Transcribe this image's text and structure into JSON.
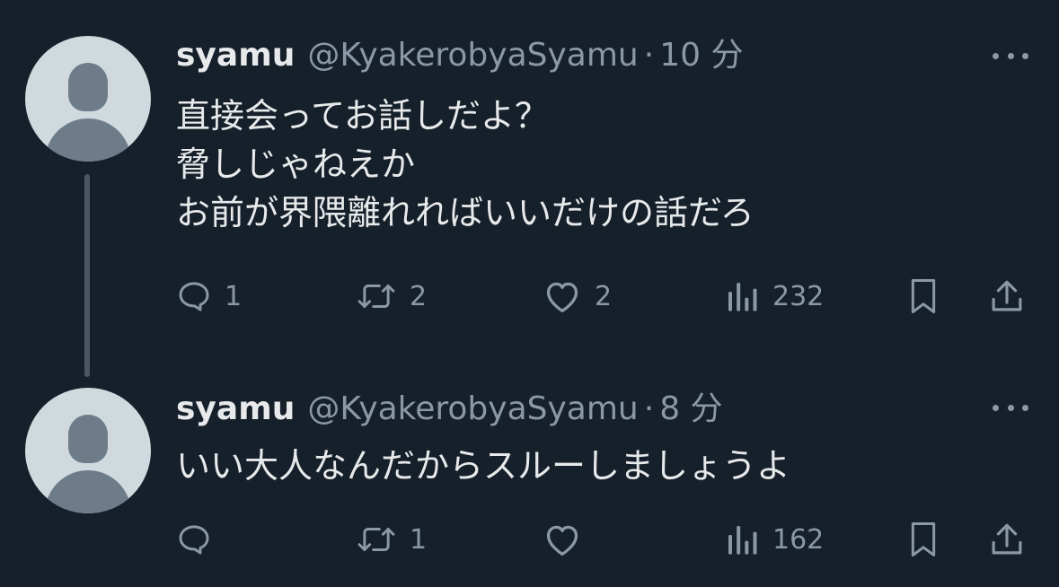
{
  "tweets": [
    {
      "display_name": "syamu",
      "handle": "@KyakerobyaSyamu",
      "separator": "·",
      "timestamp": "10 分",
      "text_lines": [
        "直接会ってお話しだよ？",
        "脅しじゃねえか",
        "お前が界隈離れればいいだけの話だろ"
      ],
      "replies": "1",
      "retweets": "2",
      "likes": "2",
      "views": "232"
    },
    {
      "display_name": "syamu",
      "handle": "@KyakerobyaSyamu",
      "separator": "·",
      "timestamp": "8 分",
      "text_lines": [
        "いい大人なんだからスルーしましょうよ"
      ],
      "replies": "",
      "retweets": "1",
      "likes": "",
      "views": "162"
    }
  ],
  "icons": {
    "reply": "speech-bubble-icon",
    "retweet": "retweet-arrows-icon",
    "like": "heart-icon",
    "views": "bar-chart-icon",
    "bookmark": "bookmark-icon",
    "share": "share-upload-icon",
    "more": "three-dots-icon"
  },
  "colors": {
    "background": "#15202b",
    "text": "#e7e9ea",
    "secondary_text": "#8b98a5",
    "avatar_bg": "#cfd9de",
    "avatar_silhouette": "#6e7c8a",
    "thread_line": "#4a5663"
  }
}
